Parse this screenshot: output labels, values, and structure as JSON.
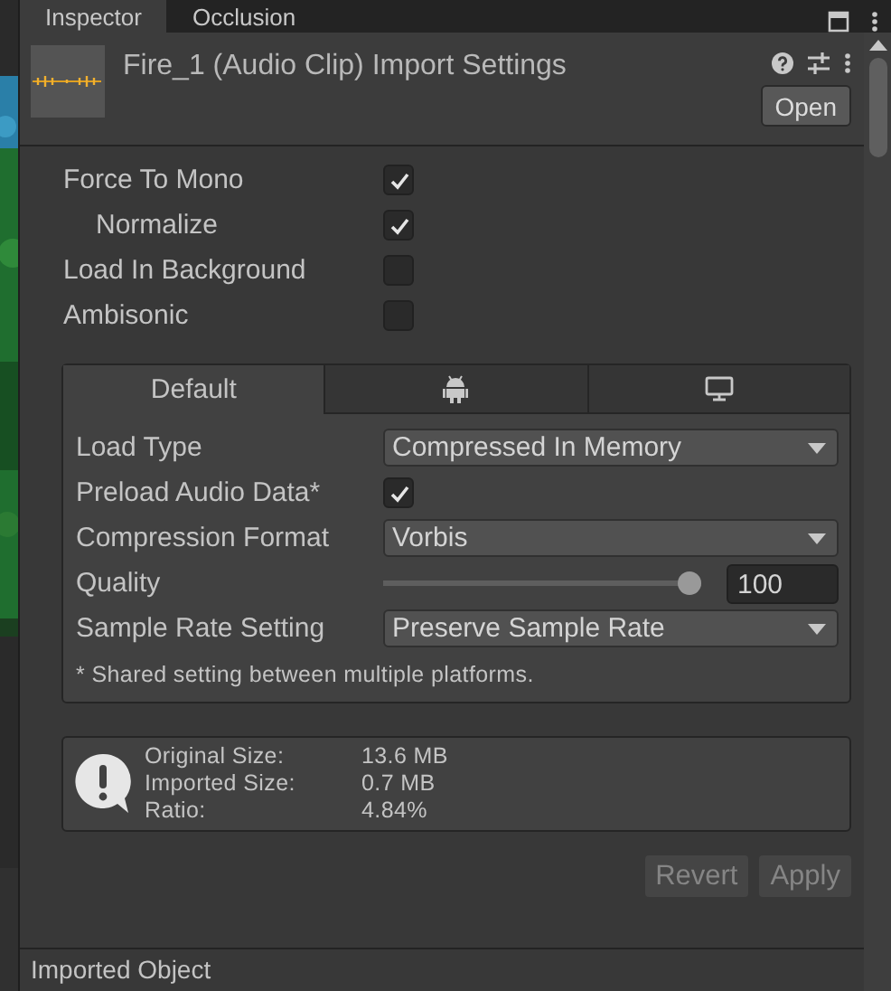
{
  "editor_tabs": [
    {
      "label": "Inspector",
      "selected": true
    },
    {
      "label": "Occlusion",
      "selected": false
    }
  ],
  "header": {
    "title": "Fire_1 (Audio Clip) Import Settings",
    "open_button": "Open"
  },
  "options": [
    {
      "label": "Force To Mono",
      "checked": true,
      "children": [
        {
          "label": "Normalize",
          "checked": true
        }
      ]
    },
    {
      "label": "Load In Background",
      "checked": false
    },
    {
      "label": "Ambisonic",
      "checked": false
    }
  ],
  "platform_tabs": [
    {
      "kind": "text",
      "label": "Default",
      "selected": true
    },
    {
      "kind": "android",
      "selected": false
    },
    {
      "kind": "desktop",
      "selected": false
    }
  ],
  "settings": [
    {
      "kind": "dropdown",
      "label": "Load Type",
      "value": "Compressed In Memory"
    },
    {
      "kind": "checkbox",
      "label": "Preload Audio Data*",
      "checked": true
    },
    {
      "kind": "dropdown",
      "label": "Compression Format",
      "value": "Vorbis"
    },
    {
      "kind": "slider",
      "label": "Quality",
      "level": 1,
      "value": "100"
    },
    {
      "kind": "dropdown",
      "label": "Sample Rate Setting",
      "value": "Preserve Sample Rate"
    }
  ],
  "footnote": "* Shared setting between multiple platforms.",
  "info": [
    {
      "label": "Original Size:",
      "value": "13.6 MB"
    },
    {
      "label": "Imported Size:",
      "value": "0.7 MB"
    },
    {
      "label": "Ratio:",
      "value": "4.84%"
    }
  ],
  "buttons": [
    {
      "label": "Revert",
      "disabled": true
    },
    {
      "label": "Apply",
      "disabled": true
    }
  ],
  "next_section": {
    "title": "Imported Object"
  }
}
